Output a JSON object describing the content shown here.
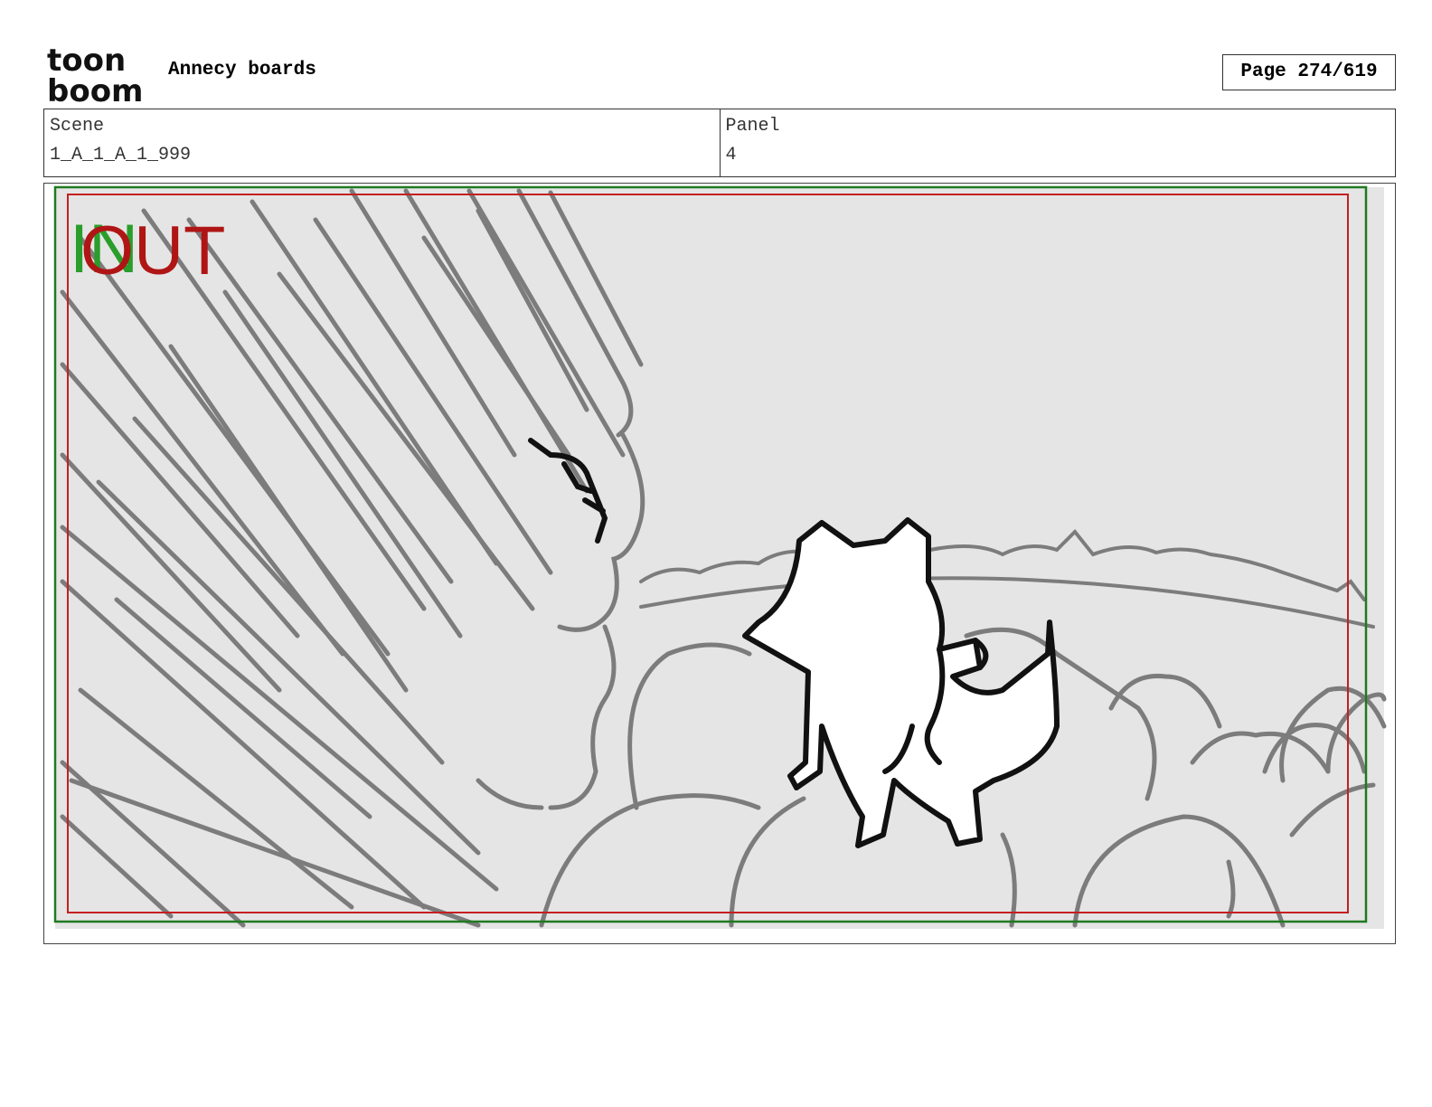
{
  "header": {
    "logo_line1": "toon",
    "logo_line2": "boom",
    "project_title": "Annecy boards",
    "page_counter": "Page 274/619"
  },
  "info": {
    "scene_label": "Scene",
    "scene_value": "1_A_1_A_1_999",
    "panel_label": "Panel",
    "panel_value": "4"
  },
  "panel": {
    "in_marker": "IN",
    "out_marker": "OUT",
    "colors": {
      "in_green": "#2a9d2a",
      "out_red": "#b01515",
      "safe_green": "#1f7a1f",
      "frame_red": "#c42020",
      "sketch_gray": "#7c7c7c",
      "background": "#e5e5e5"
    }
  }
}
